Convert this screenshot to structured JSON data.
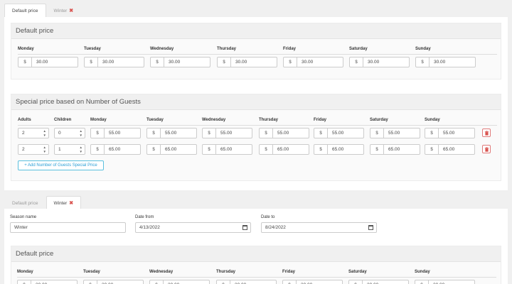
{
  "days": [
    "Monday",
    "Tuesday",
    "Wednesday",
    "Thursday",
    "Friday",
    "Saturday",
    "Sunday"
  ],
  "currency": "$",
  "tabs_top": [
    {
      "label": "Default price",
      "active": true,
      "closable": false
    },
    {
      "label": "Winter",
      "active": false,
      "closable": true
    }
  ],
  "tabs_bottom": [
    {
      "label": "Default price",
      "active": false,
      "closable": false
    },
    {
      "label": "Winter",
      "active": true,
      "closable": true
    }
  ],
  "default_price": {
    "title": "Default price",
    "values": [
      "30.00",
      "30.00",
      "30.00",
      "30.00",
      "30.00",
      "30.00",
      "30.00"
    ]
  },
  "special": {
    "title": "Special price based on Number of Guests",
    "headers": [
      "Adults",
      "Children",
      "Monday",
      "Tuesday",
      "Wednesday",
      "Thursday",
      "Friday",
      "Saturday",
      "Sunday"
    ],
    "rows": [
      {
        "adults": "2",
        "children": "0",
        "prices": [
          "55.00",
          "55.00",
          "55.00",
          "55.00",
          "55.00",
          "55.00",
          "55.00"
        ]
      },
      {
        "adults": "2",
        "children": "1",
        "prices": [
          "65.00",
          "65.00",
          "65.00",
          "65.00",
          "65.00",
          "65.00",
          "65.00"
        ]
      }
    ],
    "add_button": "+ Add Number of Guests Special Price"
  },
  "season": {
    "name_label": "Season name",
    "name_value": "Winter",
    "from_label": "Date from",
    "from_value": "4/13/2022",
    "to_label": "Date to",
    "to_value": "8/24/2022"
  },
  "winter_default": {
    "title": "Default price"
  },
  "colors": {
    "delete": "#d9534f",
    "add_button": "#5bc0de"
  }
}
